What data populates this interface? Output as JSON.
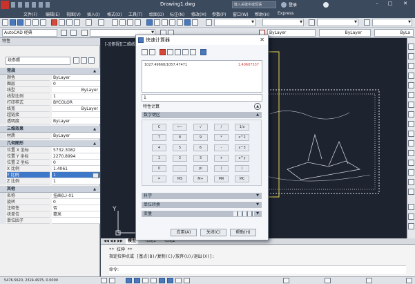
{
  "window": {
    "title": "Drawing1.dwg",
    "search_placeholder": "键入关键字或短语",
    "user": "登录"
  },
  "menu": [
    "文件(F)",
    "编辑(E)",
    "视图(V)",
    "插入(I)",
    "格式(O)",
    "工具(T)",
    "绘图(D)",
    "标注(N)",
    "修改(M)",
    "参数(P)",
    "窗口(W)",
    "帮助(H)",
    "Express"
  ],
  "toolbar": {
    "workspace": "AutoCAD 经典",
    "layer": "ByLayer",
    "linetype": "ByLayer",
    "lineweight": "ByLa"
  },
  "properties": {
    "header": "特性",
    "selector": "块参照",
    "sections": [
      {
        "title": "常规",
        "rows": [
          [
            "颜色",
            "ByLayer"
          ],
          [
            "图层",
            "0"
          ],
          [
            "线型",
            "ByLayer"
          ],
          [
            "线型比例",
            "1"
          ],
          [
            "打印样式",
            "BYCOLOR"
          ],
          [
            "线宽",
            "ByLayer"
          ],
          [
            "超链接",
            ""
          ],
          [
            "透明度",
            "ByLayer"
          ]
        ]
      },
      {
        "title": "三维效果",
        "rows": [
          [
            "材质",
            "ByLayer"
          ]
        ]
      },
      {
        "title": "几何图形",
        "rows": [
          [
            "位置 X 坐标",
            "5732.3082"
          ],
          [
            "位置 Y 坐标",
            "2270.8994"
          ],
          [
            "位置 Z 坐标",
            "0"
          ],
          [
            "X 比例",
            "1.4061"
          ],
          [
            "Y 比例",
            "1"
          ],
          [
            "Z 比例",
            "1"
          ]
        ]
      },
      {
        "title": "其他",
        "rows": [
          [
            "名称",
            "挂画(L)-01"
          ],
          [
            "旋转",
            "0"
          ],
          [
            "注释性",
            "否"
          ],
          [
            "块单位",
            "毫米"
          ],
          [
            "单位因子",
            ""
          ]
        ]
      }
    ]
  },
  "drawing": {
    "viewport_label": "[-][俯视][二维线框]",
    "axis_y": "Y",
    "axis_x": "X"
  },
  "layout_tabs": [
    "模型",
    "布局1",
    "布局2"
  ],
  "command": {
    "line1": "** 拉伸 **",
    "line2": "指定拉伸点或 [基点(B)/复制(C)/放弃(U)/退出(X)]:",
    "prompt": "命令:"
  },
  "status": {
    "coords": "5476.5620, 2324.4975, 0.0000"
  },
  "calculator": {
    "title": "快速计算器",
    "history_expr": "1027.49668/1057.47471",
    "history_result": "1.40607537",
    "input_value": "1",
    "sections": [
      "数字键区",
      "科学",
      "单位转换",
      "变量"
    ],
    "feature_label": "特性计算",
    "keypad": [
      [
        "C",
        "⟵",
        "√",
        "/",
        "1/x"
      ],
      [
        "7",
        "8",
        "9",
        "*",
        "x^2"
      ],
      [
        "4",
        "5",
        "6",
        "-",
        "x^3"
      ],
      [
        "1",
        "2",
        "3",
        "+",
        "x^y"
      ],
      [
        "0",
        ".",
        "pi",
        "(",
        ")"
      ],
      [
        "=",
        "MS",
        "M+",
        "MR",
        "MC"
      ]
    ],
    "buttons": {
      "apply": "应用(A)",
      "close": "关闭(C)",
      "help": "帮助(H)"
    }
  }
}
